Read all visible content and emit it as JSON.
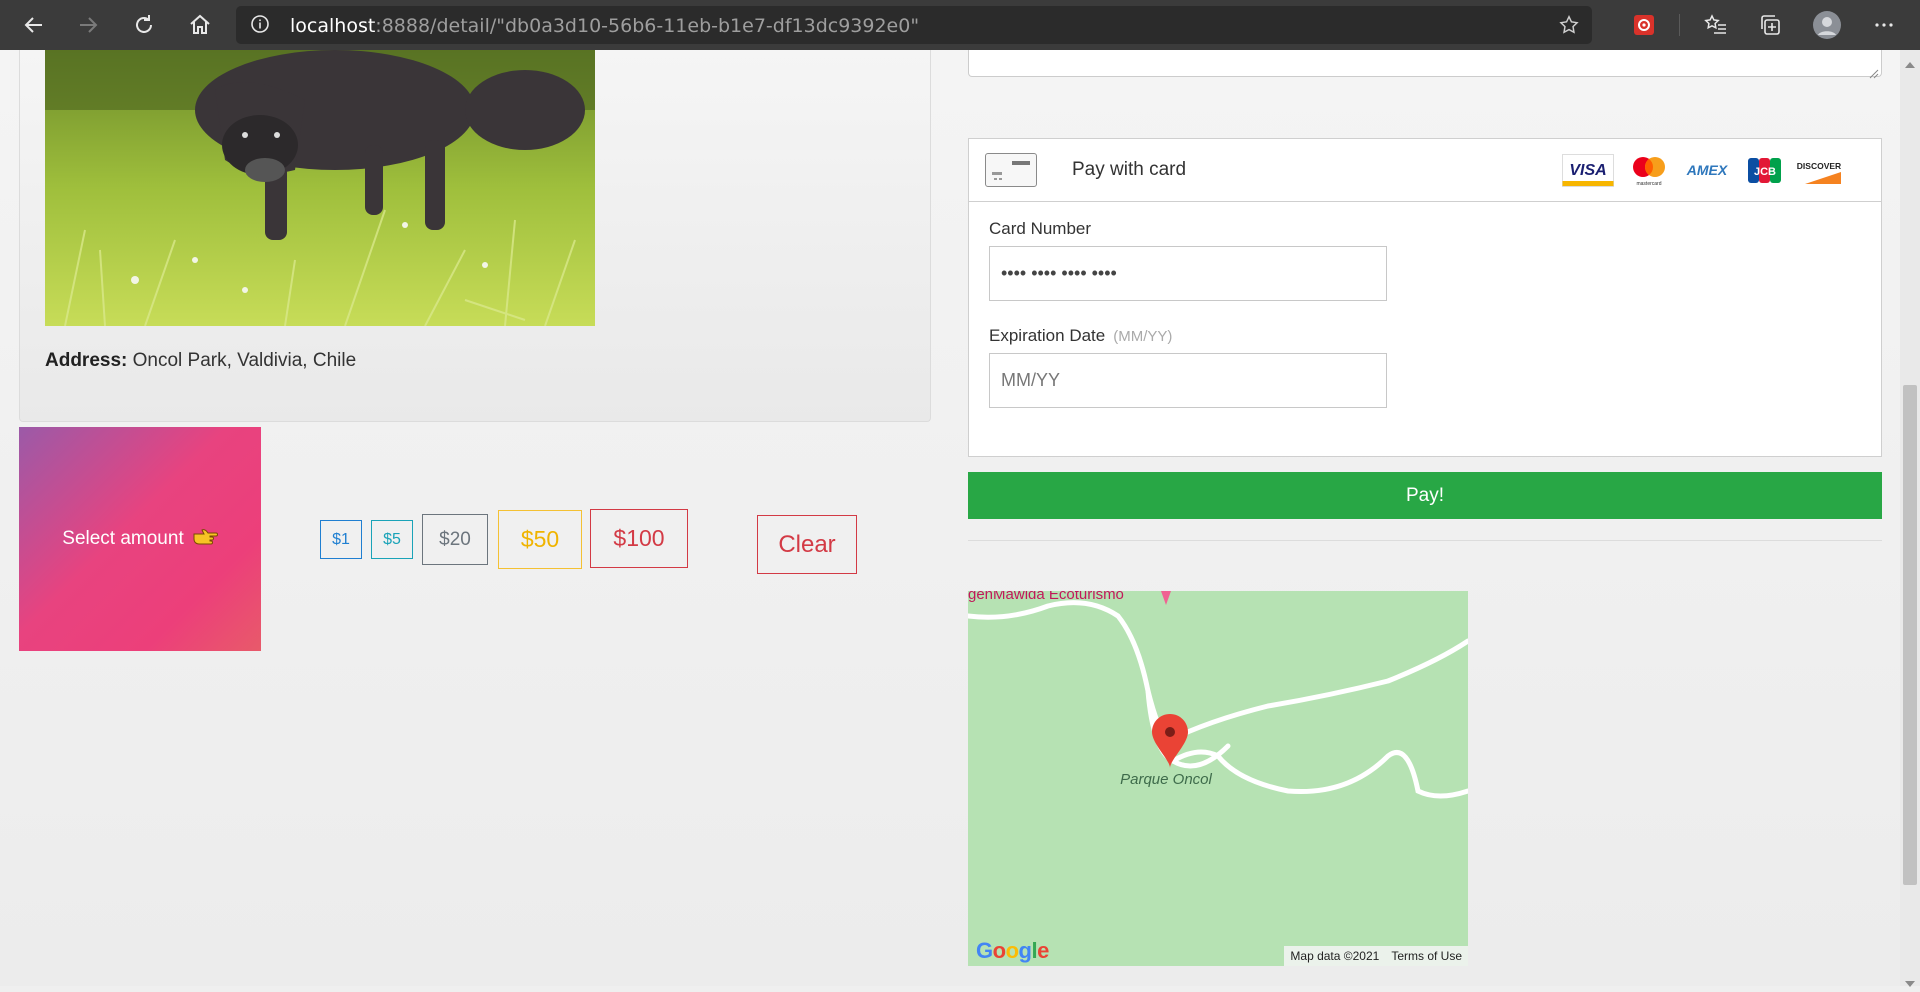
{
  "browser": {
    "url_host": "localhost",
    "url_rest": ":8888/detail/\"db0a3d10-56b6-11eb-b1e7-df13dc9392e0\""
  },
  "detail": {
    "address_label": "Address:",
    "address_value": "Oncol Park, Valdivia, Chile"
  },
  "donate": {
    "select_amount_label": "Select amount",
    "amounts": [
      "$1",
      "$5",
      "$20",
      "$50",
      "$100"
    ],
    "clear_label": "Clear"
  },
  "payment": {
    "header_label": "Pay with card",
    "brands": [
      "VISA",
      "mastercard",
      "AMEX",
      "JCB",
      "DISCOVER"
    ],
    "card_number_label": "Card Number",
    "card_number_placeholder": "•••• •••• •••• ••••",
    "expiration_label": "Expiration Date",
    "expiration_hint": "(MM/YY)",
    "expiration_placeholder": "MM/YY",
    "pay_label": "Pay!"
  },
  "map": {
    "place_label": "Parque Oncol",
    "poi_label": "genMawida Ecoturismo",
    "logo": "Google",
    "map_data": "Map data ©2021",
    "terms": "Terms of Use"
  },
  "colors": {
    "pay_green": "#28a745",
    "primary_blue": "#1f7fd1",
    "info_teal": "#1aa3b8",
    "warning_yellow": "#f0b400",
    "danger_red": "#d33a45",
    "map_green": "#b6e2b3"
  }
}
